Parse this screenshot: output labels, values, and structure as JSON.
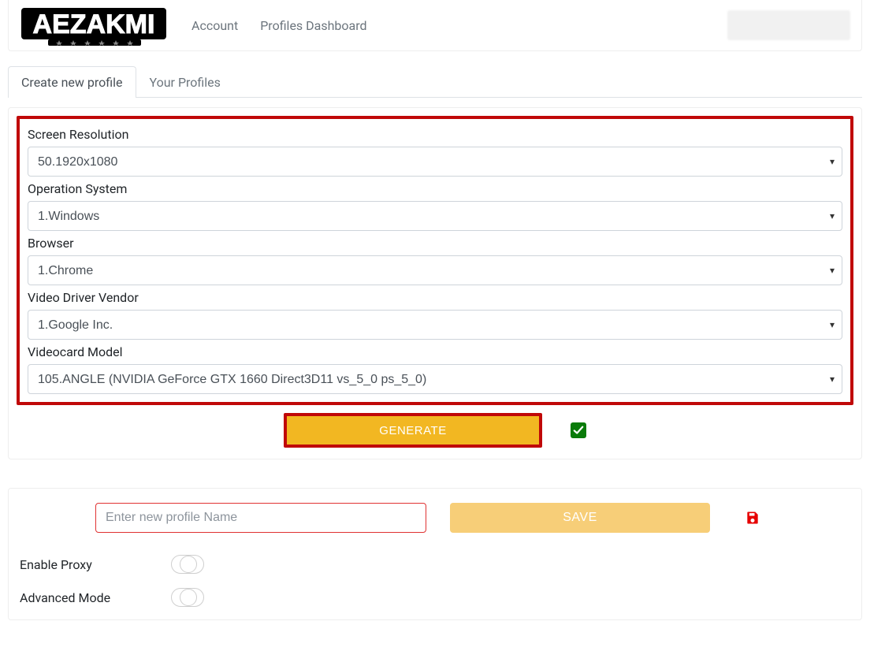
{
  "nav": {
    "account": "Account",
    "dashboard": "Profiles Dashboard"
  },
  "tabs": {
    "create": "Create new profile",
    "yours": "Your Profiles"
  },
  "form": {
    "screen_label": "Screen Resolution",
    "screen_value": "50.1920x1080",
    "os_label": "Operation System",
    "os_value": "1.Windows",
    "browser_label": "Browser",
    "browser_value": "1.Chrome",
    "vvendor_label": "Video Driver Vendor",
    "vvendor_value": "1.Google Inc.",
    "vmodel_label": "Videocard Model",
    "vmodel_value": "105.ANGLE (NVIDIA GeForce GTX 1660 Direct3D11 vs_5_0 ps_5_0)"
  },
  "buttons": {
    "generate": "GENERATE",
    "save": "SAVE"
  },
  "profile_name_placeholder": "Enter new profile Name",
  "toggles": {
    "proxy": "Enable Proxy",
    "advanced": "Advanced Mode"
  }
}
